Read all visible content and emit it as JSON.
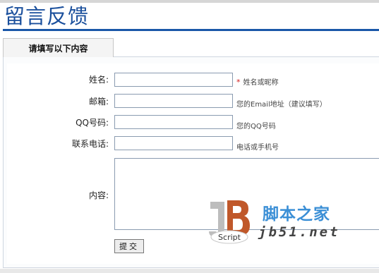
{
  "header": {
    "title": "留言反馈"
  },
  "tab": {
    "label": "请填写以下内容"
  },
  "form": {
    "name": {
      "label": "姓名:",
      "required_mark": "*",
      "hint": "姓名或昵称",
      "value": ""
    },
    "email": {
      "label": "邮箱:",
      "hint": "您的Email地址（建议填写）",
      "value": ""
    },
    "qq": {
      "label": "QQ号码:",
      "hint": "您的QQ号码",
      "value": ""
    },
    "phone": {
      "label": "联系电话:",
      "hint": "电话或手机号",
      "value": ""
    },
    "content": {
      "label": "内容:",
      "value": ""
    },
    "submit_label": "提交"
  },
  "watermark": {
    "logo_text": "Script",
    "site_name_cn": "脚本之家",
    "site_url": "jb51.net",
    "colors": {
      "logo_j": "#bdbdbd",
      "logo_b": "#c0582a",
      "cn": "#3b8fd6"
    }
  }
}
